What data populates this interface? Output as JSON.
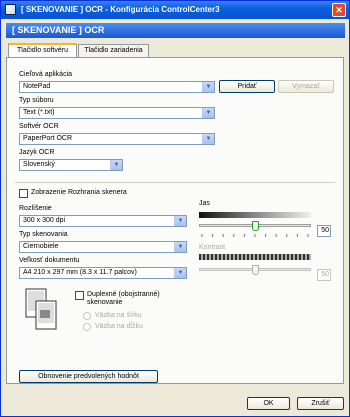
{
  "window": {
    "title": "[ SKENOVANIE ]  OCR - Konfigurácia ControlCenter3",
    "close_label": "✕"
  },
  "banner": {
    "title": "[ SKENOVANIE ]   OCR"
  },
  "tabs": [
    {
      "label": "Tlačidlo softvéru",
      "active": true
    },
    {
      "label": "Tlačidlo zariadenia",
      "active": false
    }
  ],
  "target_app": {
    "label": "Cieľová aplikácia",
    "value": "NotePad",
    "add_button": "Pridať",
    "delete_button": "Vymazať"
  },
  "file_type": {
    "label": "Typ súboru",
    "value": "Text (*.txt)"
  },
  "ocr_software": {
    "label": "Softvér OCR",
    "value": "PaperPort OCR"
  },
  "ocr_language": {
    "label": "Jazyk OCR",
    "value": "Slovenský"
  },
  "scanner_interface": {
    "label": "Zobrazenie Rozhrania skenera",
    "checked": false
  },
  "resolution": {
    "label": "Rozlíšenie",
    "value": "300 x 300 dpi"
  },
  "scan_type": {
    "label": "Typ skenovania",
    "value": "Čiernobiele"
  },
  "document_size": {
    "label": "Veľkosť dokumentu",
    "value": "A4 210 x 297 mm (8.3 x 11.7 palcov)"
  },
  "brightness": {
    "label": "Jas",
    "value": "50",
    "level_percent": 50
  },
  "contrast": {
    "label": "Kontrast",
    "value": "50",
    "level_percent": 50,
    "enabled": false
  },
  "duplex": {
    "label_line1": "Duplexné (obojstranné)",
    "label_line2": "skenovanie",
    "checked": false,
    "options": [
      "Väzba na šírku",
      "Väzba na dĺžku"
    ]
  },
  "restore_defaults_button": "Obnovenie predvolených hodnôt",
  "ok_button": "OK",
  "cancel_button": "Zrušiť",
  "colors": {
    "title_bar": "#0a5fe0",
    "banner": "#1a5ad0",
    "tab_highlight": "#f1b53a",
    "slider_thumb_border": "#21a121"
  }
}
